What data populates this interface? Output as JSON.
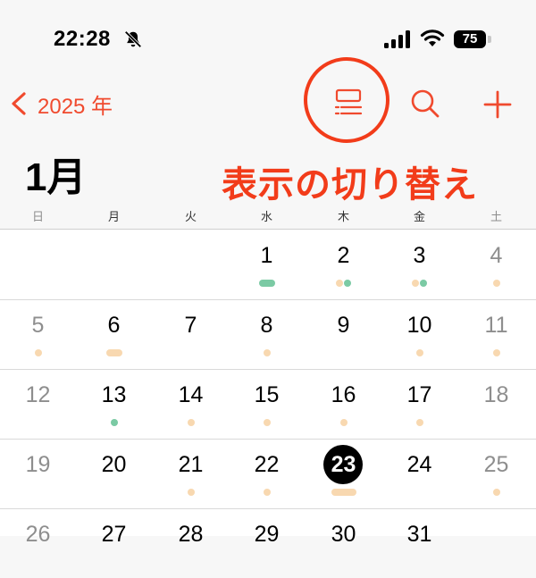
{
  "status_bar": {
    "time": "22:28",
    "battery": "75"
  },
  "nav": {
    "back_label": "2025 年"
  },
  "month": {
    "title": "1月"
  },
  "annotation": {
    "text": "表示の切り替え"
  },
  "weekdays": [
    "日",
    "月",
    "火",
    "水",
    "木",
    "金",
    "土"
  ],
  "colors": {
    "accent": "#f04a2e",
    "annotation": "#f23c1a",
    "event_green": "#7bcaa4",
    "event_peach": "#f8d8b0"
  },
  "icons": [
    "bell-slash-icon",
    "signal-icon",
    "wifi-icon",
    "chevron-left-icon",
    "list-view-icon",
    "search-icon",
    "plus-icon"
  ],
  "weeks": [
    [
      {
        "day": ""
      },
      {
        "day": ""
      },
      {
        "day": ""
      },
      {
        "day": "1",
        "marks": [
          "green-wide"
        ]
      },
      {
        "day": "2",
        "marks": [
          "peach",
          "green"
        ]
      },
      {
        "day": "3",
        "marks": [
          "peach",
          "green"
        ]
      },
      {
        "day": "4",
        "off": true,
        "marks": [
          "peach"
        ]
      }
    ],
    [
      {
        "day": "5",
        "off": true,
        "marks": [
          "peach"
        ]
      },
      {
        "day": "6",
        "marks": [
          "peach-wide"
        ]
      },
      {
        "day": "7"
      },
      {
        "day": "8",
        "marks": [
          "peach"
        ]
      },
      {
        "day": "9"
      },
      {
        "day": "10",
        "marks": [
          "peach"
        ]
      },
      {
        "day": "11",
        "off": true,
        "marks": [
          "peach"
        ]
      }
    ],
    [
      {
        "day": "12",
        "off": true
      },
      {
        "day": "13",
        "marks": [
          "green"
        ]
      },
      {
        "day": "14",
        "marks": [
          "peach"
        ]
      },
      {
        "day": "15",
        "marks": [
          "peach"
        ]
      },
      {
        "day": "16",
        "marks": [
          "peach"
        ]
      },
      {
        "day": "17",
        "marks": [
          "peach"
        ]
      },
      {
        "day": "18",
        "off": true
      }
    ],
    [
      {
        "day": "19",
        "off": true
      },
      {
        "day": "20"
      },
      {
        "day": "21",
        "marks": [
          "peach"
        ]
      },
      {
        "day": "22",
        "marks": [
          "peach"
        ]
      },
      {
        "day": "23",
        "today": true,
        "marks": [
          "peach-xwide"
        ]
      },
      {
        "day": "24"
      },
      {
        "day": "25",
        "off": true,
        "marks": [
          "peach"
        ]
      }
    ],
    [
      {
        "day": "26",
        "off": true
      },
      {
        "day": "27"
      },
      {
        "day": "28"
      },
      {
        "day": "29"
      },
      {
        "day": "30"
      },
      {
        "day": "31"
      },
      {
        "day": ""
      }
    ]
  ]
}
